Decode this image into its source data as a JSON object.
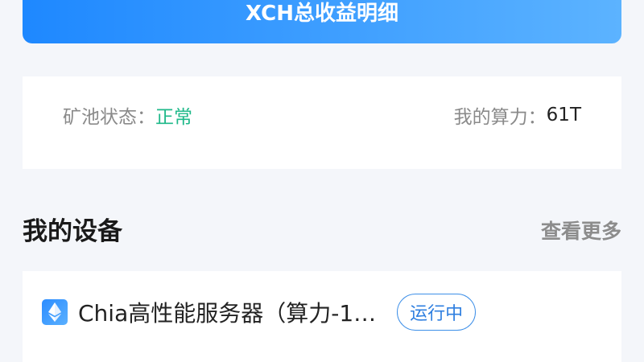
{
  "banner": {
    "label": "XCH总收益明细"
  },
  "status": {
    "pool_label": "矿池状态：",
    "pool_value": "正常",
    "hash_label": "我的算力：",
    "hash_value": "61T"
  },
  "devices": {
    "title": "我的设备",
    "more_label": "查看更多",
    "items": [
      {
        "name": "Chia高性能服务器（算力-1…",
        "status": "运行中",
        "icon": "ethereum-icon"
      }
    ]
  },
  "colors": {
    "accent": "#1e88ff",
    "status_ok": "#1fb98a",
    "badge_blue": "#2f7fe0"
  }
}
